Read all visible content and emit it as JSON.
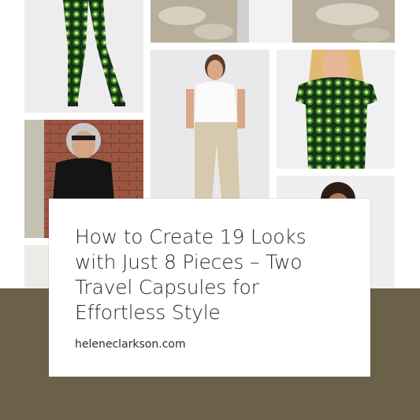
{
  "card": {
    "title": "How to Create 19 Looks with Just 8 Pieces – Two Travel Capsules for Effortless Style",
    "site": "heleneclarkson.com"
  },
  "colors": {
    "band": "#6a6148",
    "card_bg": "#ffffff",
    "text": "#2b2b2b",
    "print_green": "#3f8d1e",
    "print_dark": "#16321a",
    "brick": "#8f4f3b",
    "khaki": "#d7c9ad"
  },
  "images": [
    "green-print-pants-photo",
    "stone-path-photo",
    "white-tee-khaki-pants-photo",
    "green-print-top-photo",
    "black-tee-brick-wall-photo",
    "woman-portrait-photo",
    "partial-photo"
  ]
}
